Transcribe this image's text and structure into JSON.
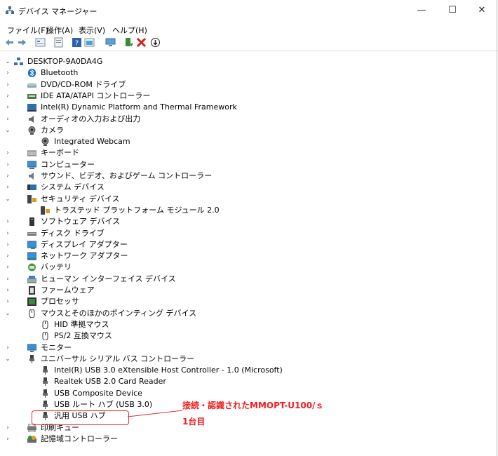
{
  "window": {
    "title": "デバイス マネージャー",
    "minimize": "—",
    "maximize": "☐",
    "close": "✕"
  },
  "menu": [
    "ファイル(F)",
    "操作(A)",
    "表示(V)",
    "ヘルプ(H)"
  ],
  "toolbar_icons": [
    "back-icon",
    "forward-icon",
    "properties-icon",
    "update-driver-icon",
    "help-icon",
    "view-icon",
    "monitor-scan-icon",
    "enable-device-icon",
    "uninstall-icon",
    "download-icon"
  ],
  "tree": {
    "root": "DESKTOP-9A0DA4G",
    "items": [
      {
        "label": "Bluetooth",
        "icon": "bluetooth-icon"
      },
      {
        "label": "DVD/CD-ROM ドライブ",
        "icon": "dvd-drive-icon"
      },
      {
        "label": "IDE ATA/ATAPI コントローラー",
        "icon": "ide-controller-icon"
      },
      {
        "label": "Intel(R) Dynamic Platform and Thermal Framework",
        "icon": "intel-framework-icon"
      },
      {
        "label": "オーディオの入力および出力",
        "icon": "audio-icon"
      },
      {
        "label": "カメラ",
        "icon": "camera-icon"
      },
      {
        "label": "Integrated Webcam",
        "icon": "webcam-icon"
      },
      {
        "label": "キーボード",
        "icon": "keyboard-icon"
      },
      {
        "label": "コンピューター",
        "icon": "computer-icon"
      },
      {
        "label": "サウンド、ビデオ、およびゲーム コントローラー",
        "icon": "sound-icon"
      },
      {
        "label": "システム デバイス",
        "icon": "system-device-icon"
      },
      {
        "label": "セキュリティ デバイス",
        "icon": "security-device-icon"
      },
      {
        "label": "トラステッド プラットフォーム モジュール 2.0",
        "icon": "tpm-icon"
      },
      {
        "label": "ソフトウェア デバイス",
        "icon": "software-device-icon"
      },
      {
        "label": "ディスク ドライブ",
        "icon": "disk-drive-icon"
      },
      {
        "label": "ディスプレイ アダプター",
        "icon": "display-adapter-icon"
      },
      {
        "label": "ネットワーク アダプター",
        "icon": "network-adapter-icon"
      },
      {
        "label": "バッテリ",
        "icon": "battery-icon"
      },
      {
        "label": "ヒューマン インターフェイス デバイス",
        "icon": "hid-icon"
      },
      {
        "label": "ファームウェア",
        "icon": "firmware-icon"
      },
      {
        "label": "プロセッサ",
        "icon": "processor-icon"
      },
      {
        "label": "マウスとそのほかのポインティング デバイス",
        "icon": "mouse-icon"
      },
      {
        "label": "HID 準拠マウス",
        "icon": "mouse-icon"
      },
      {
        "label": "PS/2 互換マウス",
        "icon": "mouse-icon"
      },
      {
        "label": "モニター",
        "icon": "monitor-icon"
      },
      {
        "label": "ユニバーサル シリアル バス コントローラー",
        "icon": "usb-icon"
      },
      {
        "label": "Intel(R) USB 3.0 eXtensible Host Controller - 1.0 (Microsoft)",
        "icon": "usb-icon"
      },
      {
        "label": "Realtek USB 2.0 Card Reader",
        "icon": "usb-icon"
      },
      {
        "label": "USB Composite Device",
        "icon": "usb-icon"
      },
      {
        "label": "USB ルート ハブ (USB 3.0)",
        "icon": "usb-icon"
      },
      {
        "label": "汎用 USB ハブ",
        "icon": "usb-icon"
      },
      {
        "label": "印刷キュー",
        "icon": "printer-icon"
      },
      {
        "label": "記憶域コントローラー",
        "icon": "storage-controller-icon"
      }
    ]
  },
  "annotation": {
    "line1": "接続・認識されたMMOPT-U100/ｓ",
    "line2": "1台目",
    "color": "#ee1c1c"
  }
}
